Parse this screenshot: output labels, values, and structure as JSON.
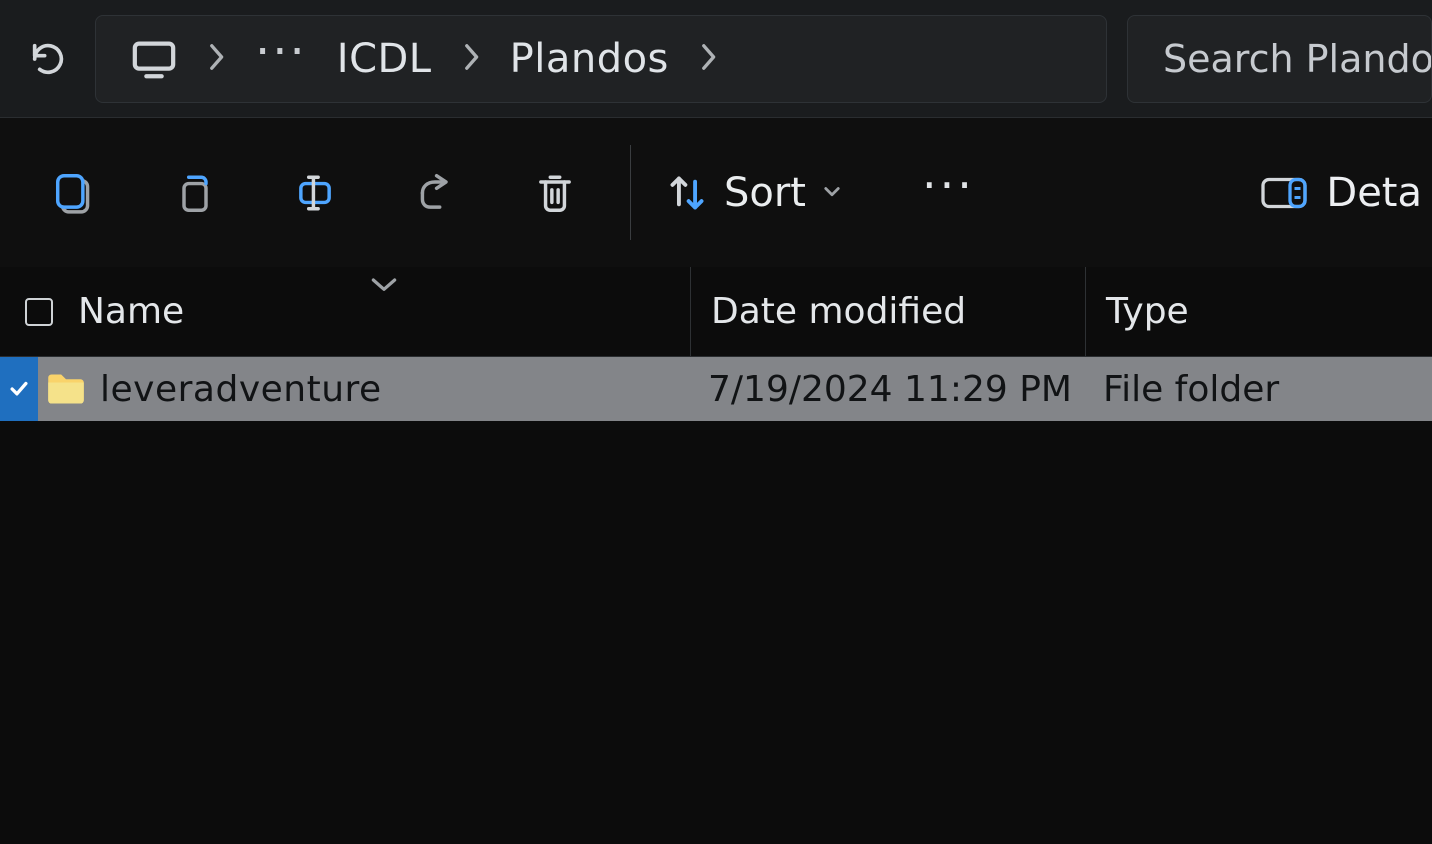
{
  "breadcrumb": {
    "parent": "ICDL",
    "current": "Plandos"
  },
  "search": {
    "placeholder": "Search Plandos"
  },
  "toolbar": {
    "sort_label": "Sort",
    "view_label": "Deta"
  },
  "columns": {
    "name": "Name",
    "date": "Date modified",
    "type": "Type"
  },
  "rows": [
    {
      "name": "leveradventure",
      "date": "7/19/2024 11:29 PM",
      "type": "File folder",
      "selected": true
    }
  ]
}
